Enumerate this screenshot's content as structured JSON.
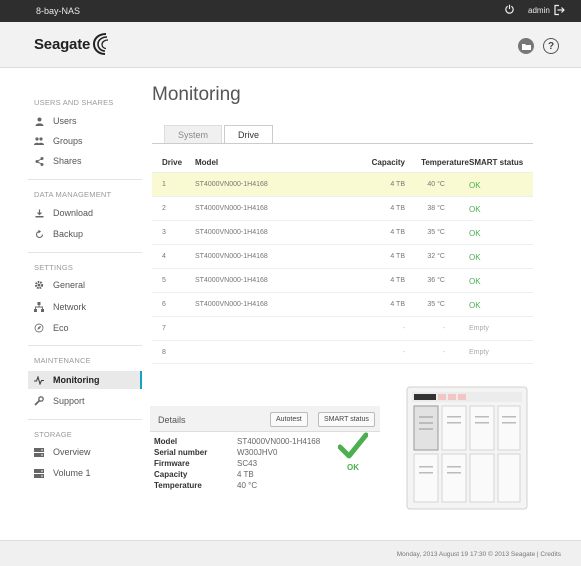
{
  "topbar": {
    "device_name": "8-bay-NAS",
    "user": "admin"
  },
  "brand": {
    "name": "Seagate"
  },
  "sidebar": {
    "sections": [
      {
        "title": "USERS AND SHARES",
        "items": [
          "Users",
          "Groups",
          "Shares"
        ]
      },
      {
        "title": "DATA MANAGEMENT",
        "items": [
          "Download",
          "Backup"
        ]
      },
      {
        "title": "SETTINGS",
        "items": [
          "General",
          "Network",
          "Eco"
        ]
      },
      {
        "title": "MAINTENANCE",
        "items": [
          "Monitoring",
          "Support"
        ]
      },
      {
        "title": "STORAGE",
        "items": [
          "Overview",
          "Volume 1"
        ]
      }
    ],
    "active_item": "Monitoring"
  },
  "main": {
    "title": "Monitoring",
    "tabs": [
      {
        "label": "System",
        "active": false
      },
      {
        "label": "Drive",
        "active": true
      }
    ],
    "table": {
      "headers": [
        "Drive",
        "Model",
        "Capacity",
        "Temperature",
        "SMART status"
      ],
      "rows": [
        {
          "drive": "1",
          "model": "ST4000VN000-1H4168",
          "capacity": "4 TB",
          "temperature": "40 °C",
          "smart": "OK",
          "selected": true
        },
        {
          "drive": "2",
          "model": "ST4000VN000-1H4168",
          "capacity": "4 TB",
          "temperature": "38 °C",
          "smart": "OK"
        },
        {
          "drive": "3",
          "model": "ST4000VN000-1H4168",
          "capacity": "4 TB",
          "temperature": "35 °C",
          "smart": "OK"
        },
        {
          "drive": "4",
          "model": "ST4000VN000-1H4168",
          "capacity": "4 TB",
          "temperature": "32 °C",
          "smart": "OK"
        },
        {
          "drive": "5",
          "model": "ST4000VN000-1H4168",
          "capacity": "4 TB",
          "temperature": "36 °C",
          "smart": "OK"
        },
        {
          "drive": "6",
          "model": "ST4000VN000-1H4168",
          "capacity": "4 TB",
          "temperature": "35 °C",
          "smart": "OK"
        },
        {
          "drive": "7",
          "model": "",
          "capacity": "-",
          "temperature": "-",
          "smart": "Empty"
        },
        {
          "drive": "8",
          "model": "",
          "capacity": "-",
          "temperature": "-",
          "smart": "Empty"
        }
      ]
    },
    "details": {
      "title": "Details",
      "autotest_label": "Autotest",
      "smart_status_label": "SMART status",
      "fields": [
        {
          "key": "Model",
          "value": "ST4000VN000-1H4168"
        },
        {
          "key": "Serial number",
          "value": "W300JHV0"
        },
        {
          "key": "Firmware",
          "value": "SC43"
        },
        {
          "key": "Capacity",
          "value": "4 TB"
        },
        {
          "key": "Temperature",
          "value": "40 °C"
        }
      ],
      "status": "OK"
    }
  },
  "footer": {
    "text": "Monday, 2013 August 19  17:30  © 2013 Seagate | Credits"
  },
  "colors": {
    "accent": "#17a1c7",
    "ok": "#4caf50",
    "selected_row": "#fafad2",
    "topbar": "#2e2e2e"
  }
}
